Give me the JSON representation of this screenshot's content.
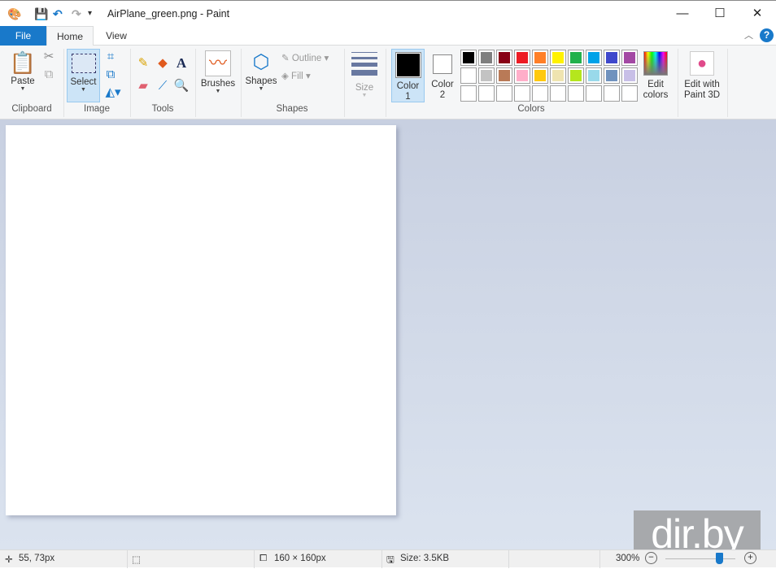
{
  "title": "AirPlane_green.png - Paint",
  "window": {
    "minimize": "—",
    "maximize": "☐",
    "close": "✕"
  },
  "tabs": {
    "file": "File",
    "home": "Home",
    "view": "View"
  },
  "ribbon": {
    "clipboard": {
      "paste": "Paste",
      "group": "Clipboard"
    },
    "image": {
      "select": "Select",
      "group": "Image"
    },
    "tools": {
      "group": "Tools"
    },
    "brushes": "Brushes",
    "shapes": {
      "shapes": "Shapes",
      "outline": "Outline",
      "fill": "Fill",
      "group": "Shapes"
    },
    "size": "Size",
    "colors": {
      "color1": "Color",
      "color1_num": "1",
      "color2": "Color",
      "color2_num": "2",
      "edit": "Edit",
      "edit2": "colors",
      "group": "Colors",
      "color1_value": "#000000",
      "color2_value": "#ffffff",
      "palette": [
        [
          "#000000",
          "#7f7f7f",
          "#880015",
          "#ed1c24",
          "#ff7f27",
          "#fff200",
          "#22b14c",
          "#00a2e8",
          "#3f48cc",
          "#a349a4"
        ],
        [
          "#ffffff",
          "#c3c3c3",
          "#b97a57",
          "#ffaec9",
          "#ffc90e",
          "#efe4b0",
          "#b5e61d",
          "#99d9ea",
          "#7092be",
          "#c8bfe7"
        ]
      ]
    },
    "paint3d": {
      "line1": "Edit with",
      "line2": "Paint 3D"
    }
  },
  "status": {
    "cursor": "55, 73px",
    "dimensions": "160 × 160px",
    "size": "Size: 3.5KB",
    "zoom": "300%",
    "zoom_level_percent": 300
  },
  "watermark": "dir.by"
}
